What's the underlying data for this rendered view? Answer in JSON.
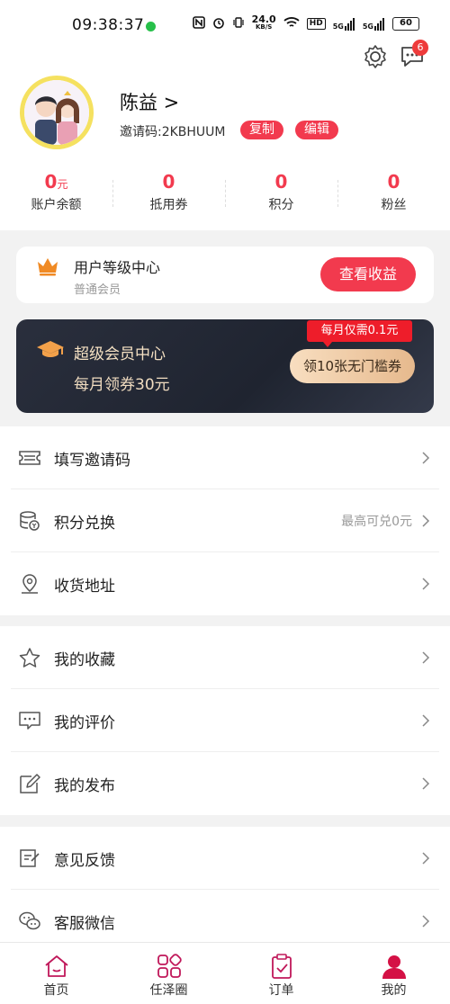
{
  "status_bar": {
    "time": "09:38:37",
    "network_speed": "24.0",
    "network_unit": "KB/S",
    "hd": "HD",
    "net1": "5G",
    "net2": "5G",
    "battery": "60"
  },
  "header": {
    "message_badge": "6",
    "user_name": "陈益 >",
    "invite_code": "邀请码:2KBHUUM",
    "copy_label": "复制",
    "edit_label": "编辑"
  },
  "stats": [
    {
      "value": "0",
      "unit": "元",
      "label": "账户余额"
    },
    {
      "value": "0",
      "unit": "",
      "label": "抵用券"
    },
    {
      "value": "0",
      "unit": "",
      "label": "积分"
    },
    {
      "value": "0",
      "unit": "",
      "label": "粉丝"
    }
  ],
  "level_card": {
    "title": "用户等级中心",
    "subtitle": "普通会员",
    "button": "查看收益"
  },
  "vip_card": {
    "title": "超级会员中心",
    "subtitle": "每月领券30元",
    "tag": "每月仅需0.1元",
    "button": "领10张无门槛券"
  },
  "menu_group1": [
    {
      "label": "填写邀请码",
      "value": ""
    },
    {
      "label": "积分兑换",
      "value": "最高可兑0元"
    },
    {
      "label": "收货地址",
      "value": ""
    }
  ],
  "menu_group2": [
    {
      "label": "我的收藏",
      "value": ""
    },
    {
      "label": "我的评价",
      "value": ""
    },
    {
      "label": "我的发布",
      "value": ""
    }
  ],
  "menu_group3": [
    {
      "label": "意见反馈",
      "value": ""
    },
    {
      "label": "客服微信",
      "value": ""
    }
  ],
  "tabbar": [
    {
      "label": "首页"
    },
    {
      "label": "任泽圈"
    },
    {
      "label": "订单"
    },
    {
      "label": "我的"
    }
  ],
  "colors": {
    "accent": "#f23a4e",
    "vip_bg": "#1f2430",
    "crown": "#f08a24"
  }
}
